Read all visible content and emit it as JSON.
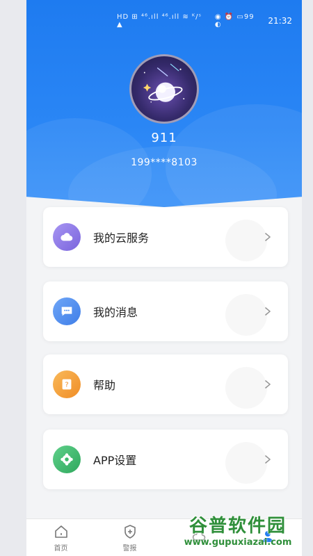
{
  "status_bar": {
    "left_icons": "HD ⊞ ⁴⁶.ıll ⁴⁶.ıll ≋ ᴷ/ˢ ▲",
    "right_icons": "◉ ⏰ ▭99 ◐",
    "time": "21:32"
  },
  "profile": {
    "username": "911",
    "phone": "199****8103"
  },
  "menu": [
    {
      "label": "我的云服务",
      "icon": "cloud-icon",
      "color": "#8b7be6"
    },
    {
      "label": "我的消息",
      "icon": "message-icon",
      "color": "#4e8ff2"
    },
    {
      "label": "帮助",
      "icon": "help-icon",
      "color": "#f4a03a"
    },
    {
      "label": "APP设置",
      "icon": "settings-icon",
      "color": "#3dbb6b"
    }
  ],
  "tabbar": {
    "tabs": [
      {
        "label": "首页",
        "icon": "home-icon"
      },
      {
        "label": "警报",
        "icon": "shield-icon"
      },
      {
        "label": "",
        "icon": "cloud-tab-icon"
      },
      {
        "label": "",
        "icon": "profile-tab-icon"
      }
    ]
  },
  "watermark": {
    "title": "谷普软件园",
    "url": "www.gupuxiazai.com"
  },
  "colors": {
    "header_blue": "#1e7bf0",
    "accent": "#1e7bf0"
  }
}
